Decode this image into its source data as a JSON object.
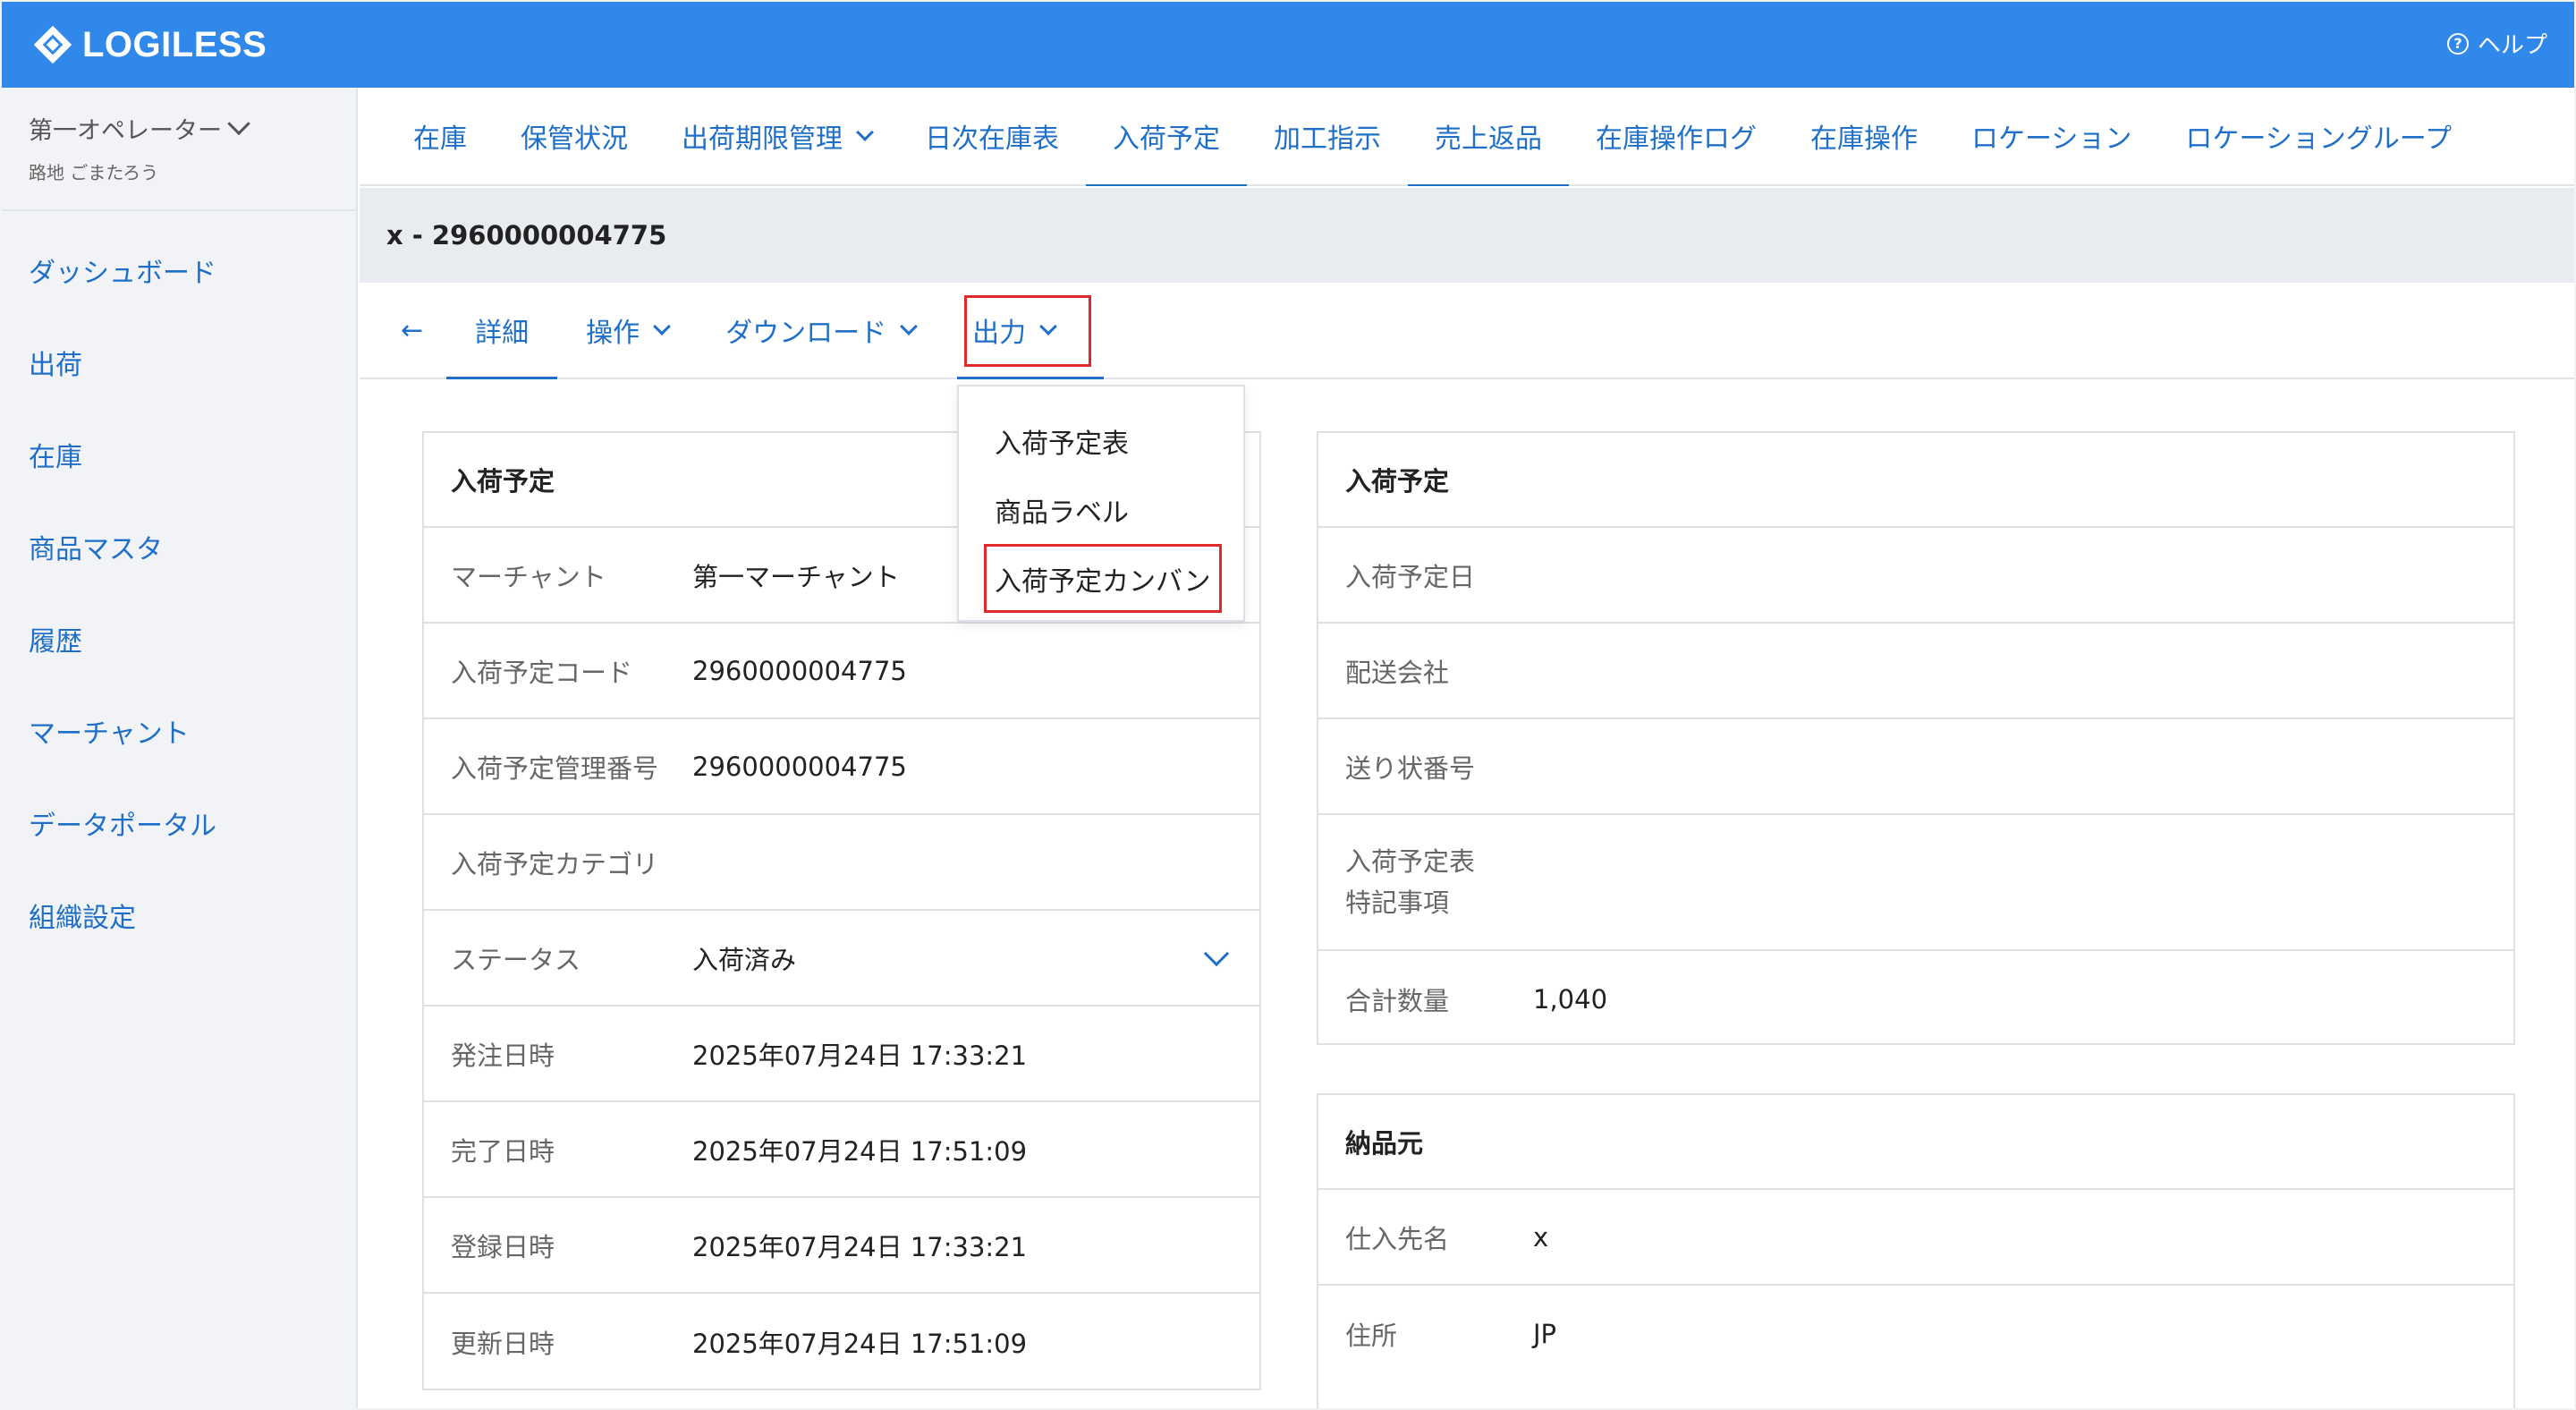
{
  "header": {
    "logo": "LOGILESS",
    "help_icon": "?",
    "help": "ヘルプ"
  },
  "sidebar": {
    "operator_name": "第一オペレーター",
    "operator_sub": "路地 ごまたろう",
    "items": [
      "ダッシュボード",
      "出荷",
      "在庫",
      "商品マスタ",
      "履歴",
      "マーチャント",
      "データポータル",
      "組織設定"
    ]
  },
  "topnav": {
    "tabs": [
      "在庫",
      "保管状況",
      "出荷期限管理",
      "日次在庫表",
      "入荷予定",
      "加工指示",
      "売上返品",
      "在庫操作ログ",
      "在庫操作",
      "ロケーション",
      "ロケーショングループ"
    ]
  },
  "record": {
    "title": "x - 2960000004775"
  },
  "subnav": {
    "back": "←",
    "detail": "詳細",
    "operation": "操作",
    "download": "ダウンロード",
    "output": "出力"
  },
  "dropdown": {
    "items": [
      "入荷予定表",
      "商品ラベル",
      "入荷予定カンバン"
    ]
  },
  "left_card": {
    "title": "入荷予定",
    "rows": [
      {
        "label": "マーチャント",
        "value": "第一マーチャント"
      },
      {
        "label": "入荷予定コード",
        "value": "2960000004775"
      },
      {
        "label": "入荷予定管理番号",
        "value": "2960000004775"
      },
      {
        "label": "入荷予定カテゴリ",
        "value": ""
      },
      {
        "label": "ステータス",
        "value": "入荷済み"
      },
      {
        "label": "発注日時",
        "value": "2025年07月24日 17:33:21"
      },
      {
        "label": "完了日時",
        "value": "2025年07月24日 17:51:09"
      },
      {
        "label": "登録日時",
        "value": "2025年07月24日 17:33:21"
      },
      {
        "label": "更新日時",
        "value": "2025年07月24日 17:51:09"
      }
    ]
  },
  "right_card": {
    "title": "入荷予定",
    "rows": [
      {
        "label": "入荷予定日",
        "value": ""
      },
      {
        "label": "配送会社",
        "value": ""
      },
      {
        "label": "送り状番号",
        "value": ""
      },
      {
        "label": "入荷予定表\n特記事項",
        "value": ""
      },
      {
        "label": "合計数量",
        "value": "1,040"
      }
    ]
  },
  "supplier_card": {
    "title": "納品元",
    "rows": [
      {
        "label": "仕入先名",
        "value": "x"
      },
      {
        "label": "住所",
        "value": "JP"
      }
    ]
  },
  "colors": {
    "header_bg": "#2f88ea",
    "link": "#1f6fc8",
    "highlight_border": "#e02a2a",
    "sidebar_bg": "#f1f3f6"
  }
}
